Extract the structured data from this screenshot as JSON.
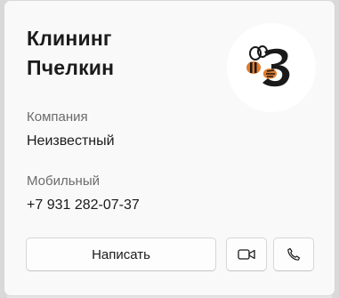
{
  "contact": {
    "name_line1": "Клининг",
    "name_line2": "Пчелкин",
    "avatar_icon": "bee-logo-icon"
  },
  "fields": {
    "company_label": "Компания",
    "company_value": "Неизвестный",
    "mobile_label": "Мобильный",
    "mobile_value": "+7 931 282-07-37"
  },
  "actions": {
    "write_label": "Написать",
    "video_icon": "video-camera-icon",
    "call_icon": "phone-icon"
  },
  "colors": {
    "card_background": "#f9f9f9",
    "bee_orange": "#e07b2c",
    "bee_black": "#1a1a1a"
  }
}
